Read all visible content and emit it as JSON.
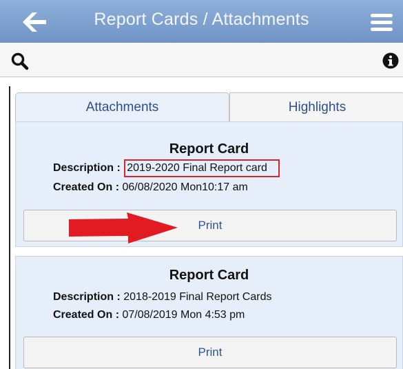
{
  "header": {
    "title": "Report Cards / Attachments",
    "back_icon": "arrow-left-icon",
    "menu_icon": "hamburger-menu-icon",
    "color": "#7fa1d1"
  },
  "toolbar": {
    "search_icon": "search-icon",
    "info_icon": "info-icon"
  },
  "tabs": [
    {
      "label": "Attachments",
      "active": true
    },
    {
      "label": "Highlights",
      "active": false
    }
  ],
  "cards": [
    {
      "title": "Report Card",
      "description_label": "Description :",
      "description": "2019-2020 Final Report card",
      "created_label": "Created On :",
      "created": "06/08/2020 Mon10:17 am",
      "print_label": "Print"
    },
    {
      "title": "Report Card",
      "description_label": "Description :",
      "description": "2018-2019 Final Report Cards",
      "created_label": "Created On :",
      "created": "07/08/2019 Mon 4:53 pm",
      "print_label": "Print"
    }
  ],
  "annotation": {
    "highlight_color": "#d8232a",
    "arrow_color": "#e21b22"
  }
}
